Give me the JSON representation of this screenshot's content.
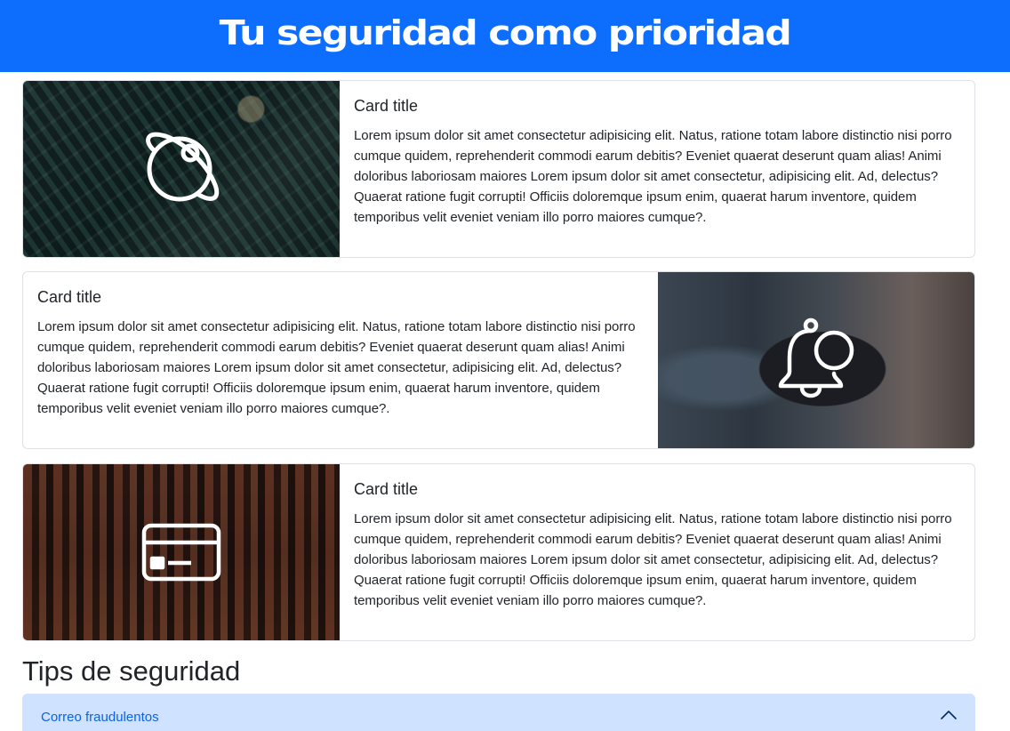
{
  "header": {
    "title": "Tu seguridad como prioridad"
  },
  "cards": [
    {
      "title": "Card title",
      "text": "Lorem ipsum dolor sit amet consectetur adipisicing elit. Natus, ratione totam labore distinctio nisi porro cumque quidem, reprehenderit commodi earum debitis? Eveniet quaerat deserunt quam alias! Animi doloribus laboriosam maiores Lorem ipsum dolor sit amet consectetur, adipisicing elit. Ad, delectus? Quaerat ratione fugit corrupti! Officiis doloremque ipsum enim, quaerat harum inventore, quidem temporibus velit eveniet veniam illo porro maiores cumque?.",
      "icon": "planet-icon"
    },
    {
      "title": "Card title",
      "text": "Lorem ipsum dolor sit amet consectetur adipisicing elit. Natus, ratione totam labore distinctio nisi porro cumque quidem, reprehenderit commodi earum debitis? Eveniet quaerat deserunt quam alias! Animi doloribus laboriosam maiores Lorem ipsum dolor sit amet consectetur, adipisicing elit. Ad, delectus? Quaerat ratione fugit corrupti! Officiis doloremque ipsum enim, quaerat harum inventore, quidem temporibus velit eveniet veniam illo porro maiores cumque?.",
      "icon": "bell-notification-icon"
    },
    {
      "title": "Card title",
      "text": "Lorem ipsum dolor sit amet consectetur adipisicing elit. Natus, ratione totam labore distinctio nisi porro cumque quidem, reprehenderit commodi earum debitis? Eveniet quaerat deserunt quam alias! Animi doloribus laboriosam maiores Lorem ipsum dolor sit amet consectetur, adipisicing elit. Ad, delectus? Quaerat ratione fugit corrupti! Officiis doloremque ipsum enim, quaerat harum inventore, quidem temporibus velit eveniet veniam illo porro maiores cumque?.",
      "icon": "credit-card-icon"
    }
  ],
  "tips": {
    "title": "Tips de seguridad",
    "accordion": [
      {
        "label": "Correo fraudulentos",
        "icon": "chevron-up-icon"
      }
    ]
  },
  "colors": {
    "primary": "#0d6efd",
    "accordion_bg": "#cfe2ff",
    "accordion_text": "#0c63e4"
  }
}
